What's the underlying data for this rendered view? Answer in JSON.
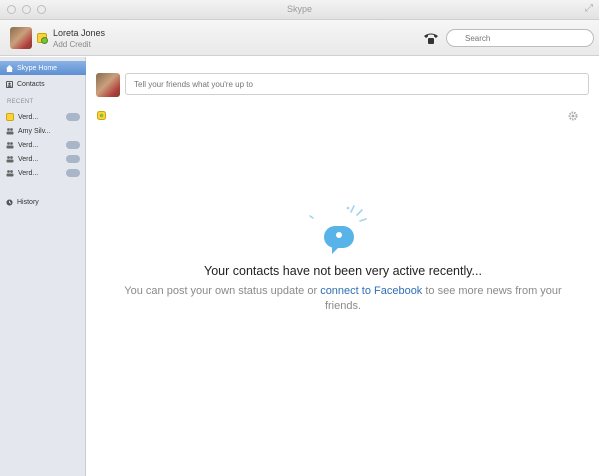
{
  "window": {
    "title": "Skype"
  },
  "header": {
    "user_name": "Loreta Jones",
    "user_sub": "Add Credit",
    "search_placeholder": "Search",
    "icons": {
      "call": "phone-icon",
      "search": "search-icon"
    }
  },
  "sidebar": {
    "items": [
      {
        "label": "Skype Home",
        "icon": "home-icon"
      },
      {
        "label": "Contacts",
        "icon": "contacts-icon"
      }
    ],
    "recent_label": "RECENT",
    "recent": [
      {
        "label": "Verd...",
        "icon": "presence-icon"
      },
      {
        "label": "Amy Silv...",
        "icon": "group-icon"
      },
      {
        "label": "Verd...",
        "icon": "group-icon"
      },
      {
        "label": "Verd...",
        "icon": "group-icon"
      },
      {
        "label": "Verd...",
        "icon": "group-icon"
      }
    ],
    "history_label": "History"
  },
  "main": {
    "status_placeholder": "Tell your friends what you're up to",
    "empty_title": "Your contacts have not been very active recently...",
    "empty_body_pre": "You can post your own status update or ",
    "empty_body_link": "connect to Facebook",
    "empty_body_post": " to see more news from your friends."
  },
  "colors": {
    "accent": "#5c8fd2",
    "link": "#2f6fb6",
    "empty_icon": "#58b3e8"
  }
}
